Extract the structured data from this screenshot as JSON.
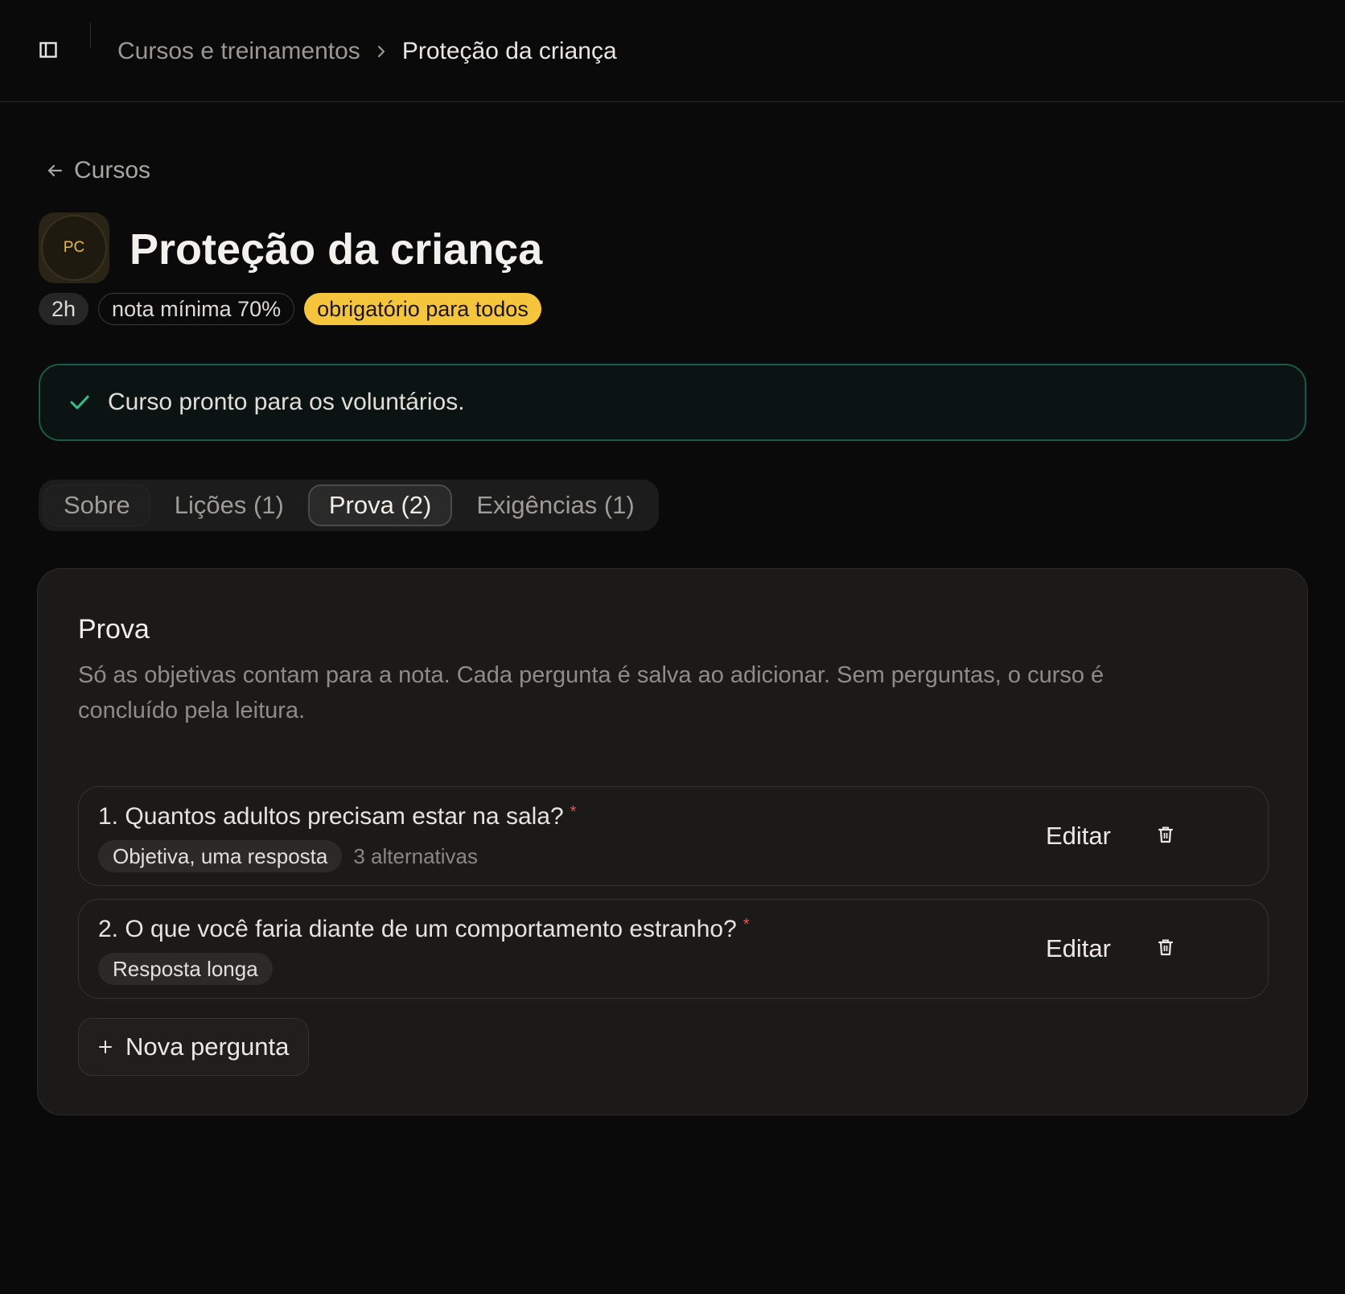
{
  "topbar": {
    "sidebar_toggle_icon": "sidebar-icon",
    "breadcrumb": {
      "parent": "Cursos e treinamentos",
      "current": "Proteção da criança"
    }
  },
  "back_link": {
    "label": "Cursos",
    "icon": "arrow-left-icon"
  },
  "course": {
    "avatar_initials": "PC",
    "title": "Proteção da criança",
    "badges": {
      "duration": "2h",
      "min_grade": "nota mínima 70%",
      "mandatory": "obrigatório para todos"
    }
  },
  "alert": {
    "icon": "check-icon",
    "text": "Curso pronto para os voluntários."
  },
  "tabs": [
    {
      "label": "Sobre",
      "active": false
    },
    {
      "label": "Lições (1)",
      "active": false
    },
    {
      "label": "Prova (2)",
      "active": true
    },
    {
      "label": "Exigências (1)",
      "active": false
    }
  ],
  "exam": {
    "title": "Prova",
    "description": "Só as objetivas contam para a nota. Cada pergunta é salva ao adicionar. Sem perguntas, o curso é concluído pela leitura.",
    "questions": [
      {
        "text": "1. Quantos adultos precisam estar na sala?",
        "required_mark": "*",
        "type": "Objetiva, uma resposta",
        "count": "3 alternativas",
        "edit_label": "Editar"
      },
      {
        "text": "2. O que você faria diante de um comportamento estranho?",
        "required_mark": "*",
        "type": "Resposta longa",
        "count": "",
        "edit_label": "Editar"
      }
    ],
    "new_question_label": "Nova pergunta"
  },
  "colors": {
    "background": "#0a0a0a",
    "card": "#1c1a19",
    "accent_yellow": "#f5c53b",
    "success_border": "#1a5a44",
    "success_icon": "#2ec28a",
    "required": "#e0565a"
  }
}
